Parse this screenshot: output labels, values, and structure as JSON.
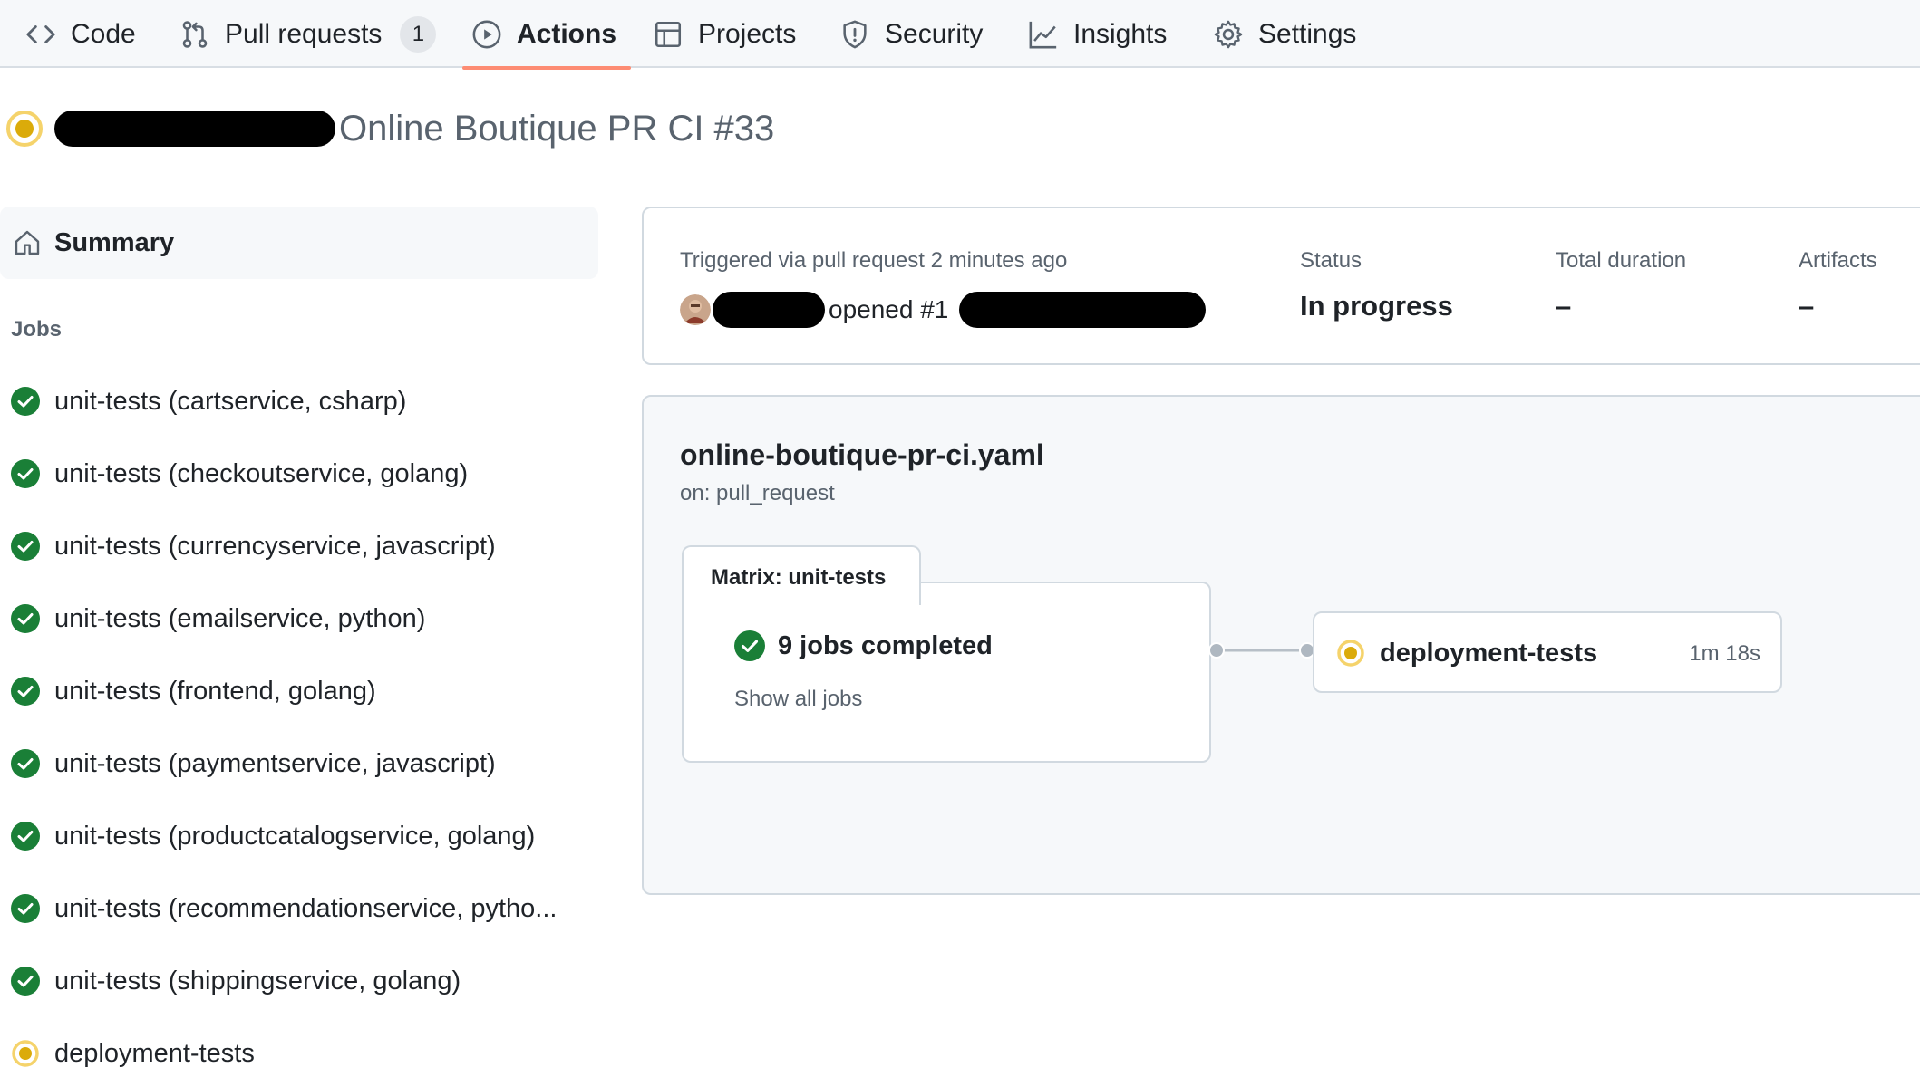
{
  "nav": {
    "tabs": [
      {
        "label": "Code",
        "icon": "code-icon"
      },
      {
        "label": "Pull requests",
        "icon": "git-pull-request-icon",
        "count": "1"
      },
      {
        "label": "Actions",
        "icon": "play-icon",
        "active": true
      },
      {
        "label": "Projects",
        "icon": "table-icon"
      },
      {
        "label": "Security",
        "icon": "shield-icon"
      },
      {
        "label": "Insights",
        "icon": "graph-icon"
      },
      {
        "label": "Settings",
        "icon": "gear-icon"
      }
    ]
  },
  "run": {
    "title": "Online Boutique PR CI #33",
    "status_icon": "in-progress-icon"
  },
  "sidebar": {
    "summary_label": "Summary",
    "jobs_heading": "Jobs",
    "jobs": [
      {
        "label": "unit-tests (cartservice, csharp)",
        "status": "success"
      },
      {
        "label": "unit-tests (checkoutservice, golang)",
        "status": "success"
      },
      {
        "label": "unit-tests (currencyservice, javascript)",
        "status": "success"
      },
      {
        "label": "unit-tests (emailservice, python)",
        "status": "success"
      },
      {
        "label": "unit-tests (frontend, golang)",
        "status": "success"
      },
      {
        "label": "unit-tests (paymentservice, javascript)",
        "status": "success"
      },
      {
        "label": "unit-tests (productcatalogservice, golang)",
        "status": "success"
      },
      {
        "label": "unit-tests (recommendationservice, pytho...",
        "status": "success"
      },
      {
        "label": "unit-tests (shippingservice, golang)",
        "status": "success"
      },
      {
        "label": "deployment-tests",
        "status": "in_progress"
      }
    ]
  },
  "summary_card": {
    "trigger_label": "Triggered via pull request 2 minutes ago",
    "trigger_action": "opened #1",
    "status_label": "Status",
    "status_value": "In progress",
    "duration_label": "Total duration",
    "duration_value": "–",
    "artifacts_label": "Artifacts",
    "artifacts_value": "–"
  },
  "workflow": {
    "file": "online-boutique-pr-ci.yaml",
    "trigger": "on: pull_request",
    "matrix_label": "Matrix: unit-tests",
    "matrix_status": "9 jobs completed",
    "matrix_link": "Show all jobs",
    "next_job": "deployment-tests",
    "next_job_duration": "1m 18s"
  },
  "colors": {
    "success": "#1a7f37",
    "in_progress": "#dbab0a",
    "active_tab_underline": "#fd8c73",
    "muted_text": "#59636e",
    "border": "#d1d9e0"
  }
}
